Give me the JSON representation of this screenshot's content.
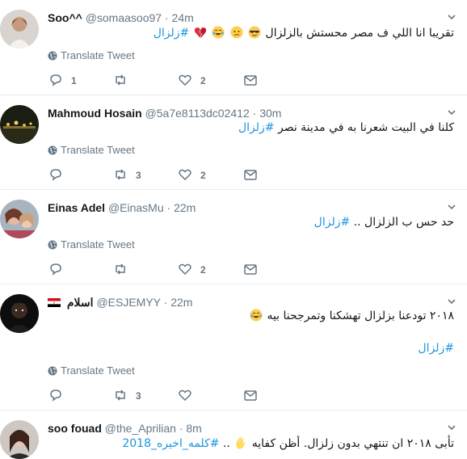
{
  "tweets": [
    {
      "name": "Soo^^",
      "handle": "@somaasoo97",
      "dot": "·",
      "time": "24m",
      "text_main": "تقريبا انا اللي ف مصر محستش بالزلزال",
      "hashtag": "#زلزال",
      "emojis": [
        "sunglasses-emoji",
        "sad-face-emoji",
        "tears-of-joy-emoji",
        "broken-heart-emoji"
      ],
      "translate": "Translate Tweet",
      "reply_count": "1",
      "retweet_count": "",
      "like_count": "2"
    },
    {
      "name": "Mahmoud Hosain",
      "handle": "@5a7e8113dc02412",
      "dot": "·",
      "time": "30m",
      "text_main": "كلنا في البيت شعرنا به في مدينة نصر",
      "hashtag": "#زلزال",
      "translate": "Translate Tweet",
      "reply_count": "",
      "retweet_count": "3",
      "like_count": "2"
    },
    {
      "name": "Einas Adel",
      "handle": "@EinasMu",
      "dot": "·",
      "time": "22m",
      "text_main": "حد حس ب الزلزال ..",
      "hashtag": "#زلزال",
      "translate": "Translate Tweet",
      "reply_count": "",
      "retweet_count": "",
      "like_count": "2"
    },
    {
      "name": "اسلام",
      "handle": "@ESJEMYY",
      "dot": "·",
      "time": "22m",
      "text_main": "٢٠١٨ تودعنا بزلزال تهشكنا وتمرجحنا بيه",
      "hashtag": "#زلزال",
      "translate": "Translate Tweet",
      "reply_count": "",
      "retweet_count": "3",
      "like_count": ""
    },
    {
      "name": "soo fouad",
      "handle": "@the_Aprilian",
      "dot": "·",
      "time": "8m",
      "text_main": "تأبى ٢٠١٨ ان تنتهي بدون زلزال. أظن كفايه",
      "text_tail": "..",
      "hashtag": "#كلمه_اخيره_2018"
    }
  ],
  "colors": {
    "link": "#1b95e0",
    "muted": "#657786",
    "divider": "#e6ecf0"
  }
}
